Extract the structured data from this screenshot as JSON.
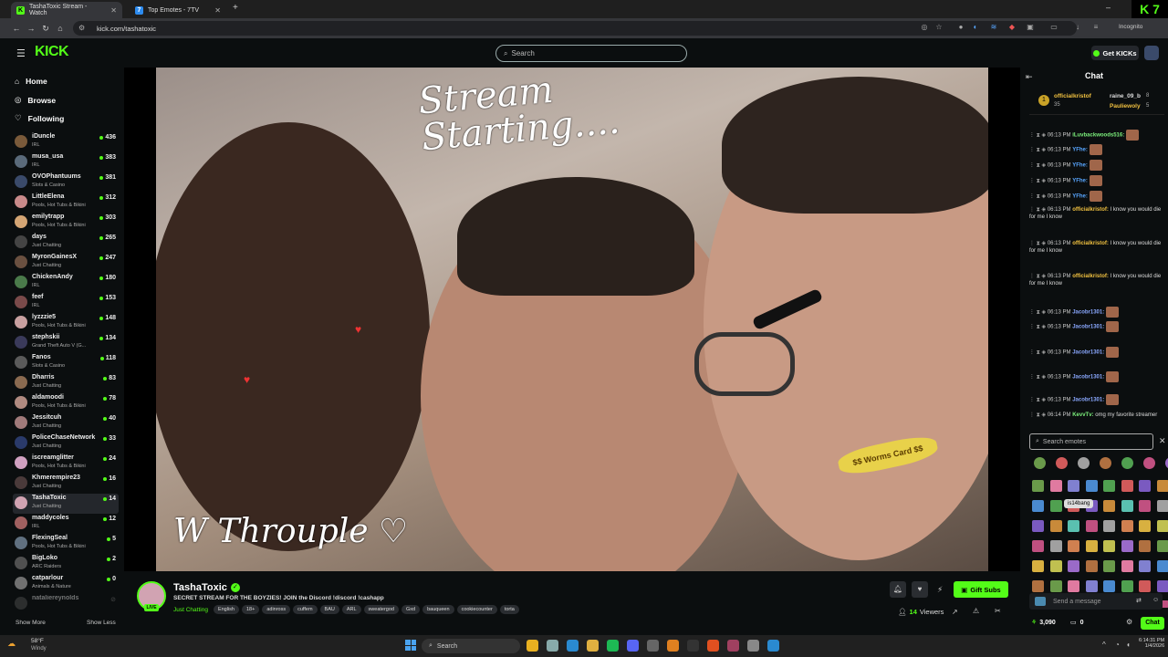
{
  "browser": {
    "tabs": [
      {
        "label": "TashaToxic Stream - Watch",
        "icon": "kick-favicon",
        "active": true
      },
      {
        "label": "Top Emotes - 7TV",
        "icon": "7tv-favicon",
        "active": false
      }
    ],
    "new_tab": "+",
    "url": "kick.com/tashatoxic",
    "incognito_label": "Incognito",
    "corner_logo": "K 7"
  },
  "header": {
    "logo": "KICK",
    "search_placeholder": "Search",
    "get_kicks_label": "Get KICKs"
  },
  "sidebar": {
    "nav": [
      {
        "label": "Home",
        "icon": "home-icon"
      },
      {
        "label": "Browse",
        "icon": "compass-icon"
      },
      {
        "label": "Following",
        "icon": "heart-icon"
      }
    ],
    "channels": [
      {
        "name": "iDuncle",
        "category": "IRL",
        "viewers": "436",
        "color": "#7a5a3a"
      },
      {
        "name": "musa_usa",
        "category": "IRL",
        "viewers": "383",
        "color": "#5a6a7a"
      },
      {
        "name": "OVOPhantuums",
        "category": "Slots & Casino",
        "viewers": "381",
        "color": "#3a4a6a"
      },
      {
        "name": "LittleElena",
        "category": "Pools, Hot Tubs & Bikini",
        "viewers": "312",
        "color": "#c98a8a"
      },
      {
        "name": "emilytrapp",
        "category": "Pools, Hot Tubs & Bikini",
        "viewers": "303",
        "color": "#d4a574"
      },
      {
        "name": "days",
        "category": "Just Chatting",
        "viewers": "265",
        "color": "#444"
      },
      {
        "name": "MyronGainesX",
        "category": "Just Chatting",
        "viewers": "247",
        "color": "#6a5040"
      },
      {
        "name": "ChickenAndy",
        "category": "IRL",
        "viewers": "180",
        "color": "#4a7a4a"
      },
      {
        "name": "feef",
        "category": "IRL",
        "viewers": "153",
        "color": "#7a4a4a"
      },
      {
        "name": "lyzzzie5",
        "category": "Pools, Hot Tubs & Bikini",
        "viewers": "148",
        "color": "#c8a0a0"
      },
      {
        "name": "stephskii",
        "category": "Grand Theft Auto V (G...",
        "viewers": "134",
        "color": "#3a3a5a"
      },
      {
        "name": "Fanos",
        "category": "Slots & Casino",
        "viewers": "118",
        "color": "#5a5a5a"
      },
      {
        "name": "Dharris",
        "category": "Just Chatting",
        "viewers": "83",
        "color": "#8a6a50"
      },
      {
        "name": "aldamoodi",
        "category": "Pools, Hot Tubs & Bikini",
        "viewers": "78",
        "color": "#b08a80"
      },
      {
        "name": "Jessitcuh",
        "category": "Just Chatting",
        "viewers": "40",
        "color": "#a07a7a"
      },
      {
        "name": "PoliceChaseNetwork",
        "category": "Just Chatting",
        "viewers": "33",
        "color": "#2a3a6a"
      },
      {
        "name": "iscreamglitter",
        "category": "Pools, Hot Tubs & Bikini",
        "viewers": "24",
        "color": "#d0a0c0"
      },
      {
        "name": "Khmerempire23",
        "category": "Just Chatting",
        "viewers": "16",
        "color": "#4a3a3a"
      },
      {
        "name": "TashaToxic",
        "category": "Just Chatting",
        "viewers": "14",
        "color": "#d1a3b2"
      },
      {
        "name": "maddycoles",
        "category": "IRL",
        "viewers": "12",
        "color": "#a06060"
      },
      {
        "name": "FlexingSeal",
        "category": "Pools, Hot Tubs & Bikini",
        "viewers": "5",
        "color": "#607080"
      },
      {
        "name": "BigLoko",
        "category": "ARC Raiders",
        "viewers": "2",
        "color": "#505050"
      },
      {
        "name": "catparlour",
        "category": "Animals & Nature",
        "viewers": "0",
        "color": "#707070"
      },
      {
        "name": "nataliereynolds",
        "category": "",
        "viewers": "",
        "color": "#555"
      }
    ],
    "show_more": "Show More",
    "show_less": "Show Less"
  },
  "video": {
    "overlay_top": "Stream\nStarting....",
    "overlay_bottom": "W Throuple ♡",
    "teeth_text": "$$ Worms Card $$"
  },
  "stream": {
    "streamer_name": "TashaToxic",
    "live_label": "LIVE",
    "title": "SECRET STREAM FOR THE BOYZIES! JOIN the Discord !discord !cashapp",
    "category": "Just Chatting",
    "tags": [
      "English",
      "18+",
      "adinross",
      "cuffem",
      "BAU",
      "ARL",
      "sweatergod",
      "Gxd",
      "bauqueen",
      "cookiecounter",
      "torta"
    ],
    "viewers_count": "14",
    "viewers_label": "Viewers",
    "gift_subs_label": "Gift Subs"
  },
  "chat": {
    "title": "Chat",
    "pinned": [
      {
        "name": "officialkristof",
        "sub": "35"
      },
      {
        "name": "raine_09_b",
        "sub": "8"
      },
      {
        "name": "Pauliewoly",
        "sub": "5"
      }
    ],
    "messages": [
      {
        "time": "06:13 PM",
        "user": "iLuvbackwoods516:",
        "text": "",
        "color": "#7cf07c"
      },
      {
        "time": "06:13 PM",
        "user": "YFhe:",
        "text": "",
        "color": "#58a6ff"
      },
      {
        "time": "06:13 PM",
        "user": "YFhe:",
        "text": "",
        "color": "#58a6ff"
      },
      {
        "time": "06:13 PM",
        "user": "YFhe:",
        "text": "",
        "color": "#58a6ff"
      },
      {
        "time": "06:13 PM",
        "user": "YFhe:",
        "text": "",
        "color": "#58a6ff"
      },
      {
        "time": "06:13 PM",
        "user": "officialkristof:",
        "text": "I know you would die for me I know",
        "color": "#f0c040"
      },
      {
        "time": "06:13 PM",
        "user": "officialkristof:",
        "text": "I know you would die for me I know",
        "color": "#f0c040"
      },
      {
        "time": "06:13 PM",
        "user": "officialkristof:",
        "text": "I know you would die for me I know",
        "color": "#f0c040"
      },
      {
        "time": "06:13 PM",
        "user": "Jacobr1301:",
        "text": "",
        "color": "#8aa8ff"
      },
      {
        "time": "06:13 PM",
        "user": "Jacobr1301:",
        "text": "",
        "color": "#8aa8ff"
      },
      {
        "time": "06:13 PM",
        "user": "Jacobr1301:",
        "text": "",
        "color": "#8aa8ff"
      },
      {
        "time": "06:13 PM",
        "user": "Jacobr1301:",
        "text": "",
        "color": "#8aa8ff"
      },
      {
        "time": "06:13 PM",
        "user": "Jacobr1301:",
        "text": "",
        "color": "#8aa8ff"
      },
      {
        "time": "06:14 PM",
        "user": "KevvTv:",
        "text": "omg my favorite streamer",
        "color": "#7cf07c"
      }
    ],
    "emote_search_placeholder": "Search emotes",
    "emote_tooltip": "is14bang",
    "send_placeholder": "Send a message",
    "points": "3,090",
    "zero": "0",
    "chat_button": "Chat"
  },
  "taskbar": {
    "weather_temp": "58°F",
    "weather_desc": "Windy",
    "search_placeholder": "Search",
    "time": "6:14:31 PM",
    "date": "1/4/2026"
  },
  "colors": {
    "accent": "#53fc18",
    "background": "#0b0e0f"
  }
}
